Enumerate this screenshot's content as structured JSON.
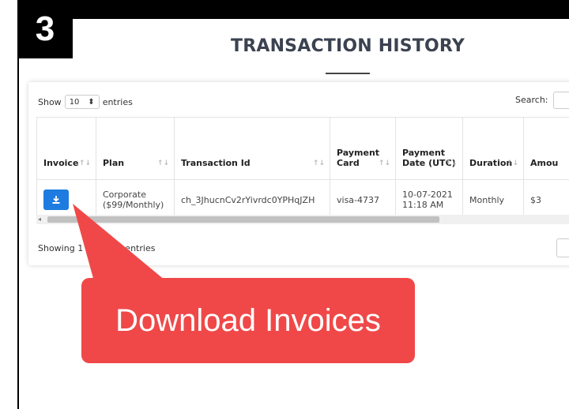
{
  "step": {
    "number": "3"
  },
  "page": {
    "title": "TRANSACTION HISTORY"
  },
  "controls": {
    "show_label": "Show",
    "entries_value": "10",
    "entries_label": "entries",
    "search_label": "Search:"
  },
  "table": {
    "columns": [
      "Invoice",
      "Plan",
      "Transaction Id",
      "Payment Card",
      "Payment Date (UTC)",
      "Duration",
      "Amou"
    ],
    "rows": [
      {
        "plan": "Corporate ($99/Monthly)",
        "transaction_id": "ch_3JhucnCv2rYivrdc0YPHqJZH",
        "payment_card": "visa-4737",
        "payment_date": "10-07-2021 11:18 AM",
        "duration": "Monthly",
        "amount": "$3"
      }
    ]
  },
  "footer": {
    "showing": "Showing 1 to 1 of 1 entries"
  },
  "callout": {
    "text": "Download Invoices",
    "color": "#f04848"
  },
  "colors": {
    "accent": "#1e7be0",
    "title": "#3b4250"
  },
  "icons": {
    "download": "download-icon",
    "sort": "sort-icon"
  }
}
